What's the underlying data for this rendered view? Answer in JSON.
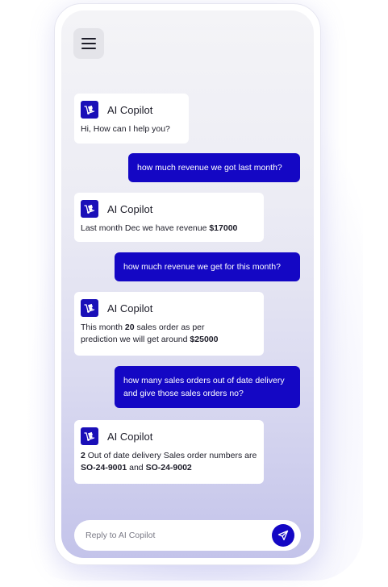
{
  "app": {
    "assistant_name": "AI Copilot"
  },
  "icons": {
    "menu": "hamburger-menu-icon",
    "avatar": "hand-truck-icon",
    "send": "paper-plane-icon"
  },
  "colors": {
    "accent": "#1407c4",
    "ai_bubble": "#ffffff"
  },
  "messages": [
    {
      "role": "ai",
      "name": "AI Copilot",
      "text": "Hi, How can I help you?"
    },
    {
      "role": "user",
      "text": "how much revenue we got last month?"
    },
    {
      "role": "ai",
      "name": "AI Copilot",
      "text_pre": "Last month Dec we have revenue ",
      "text_bold": "$17000"
    },
    {
      "role": "user",
      "text": "how much revenue we get for this month?"
    },
    {
      "role": "ai",
      "name": "AI Copilot",
      "text_a": "This month ",
      "bold_a": "20",
      "text_b": " sales order as per prediction we will get around ",
      "bold_b": "$25000"
    },
    {
      "role": "user",
      "text": "how many sales orders out of date delivery and give those sales orders no?"
    },
    {
      "role": "ai",
      "name": "AI Copilot",
      "bold_a": "2",
      "text_a": " Out of date delivery Sales order numbers are ",
      "bold_b": "SO-24-9001",
      "text_b": " and ",
      "bold_c": "SO-24-9002"
    }
  ],
  "reply": {
    "placeholder": "Reply to AI Copilot",
    "value": ""
  }
}
